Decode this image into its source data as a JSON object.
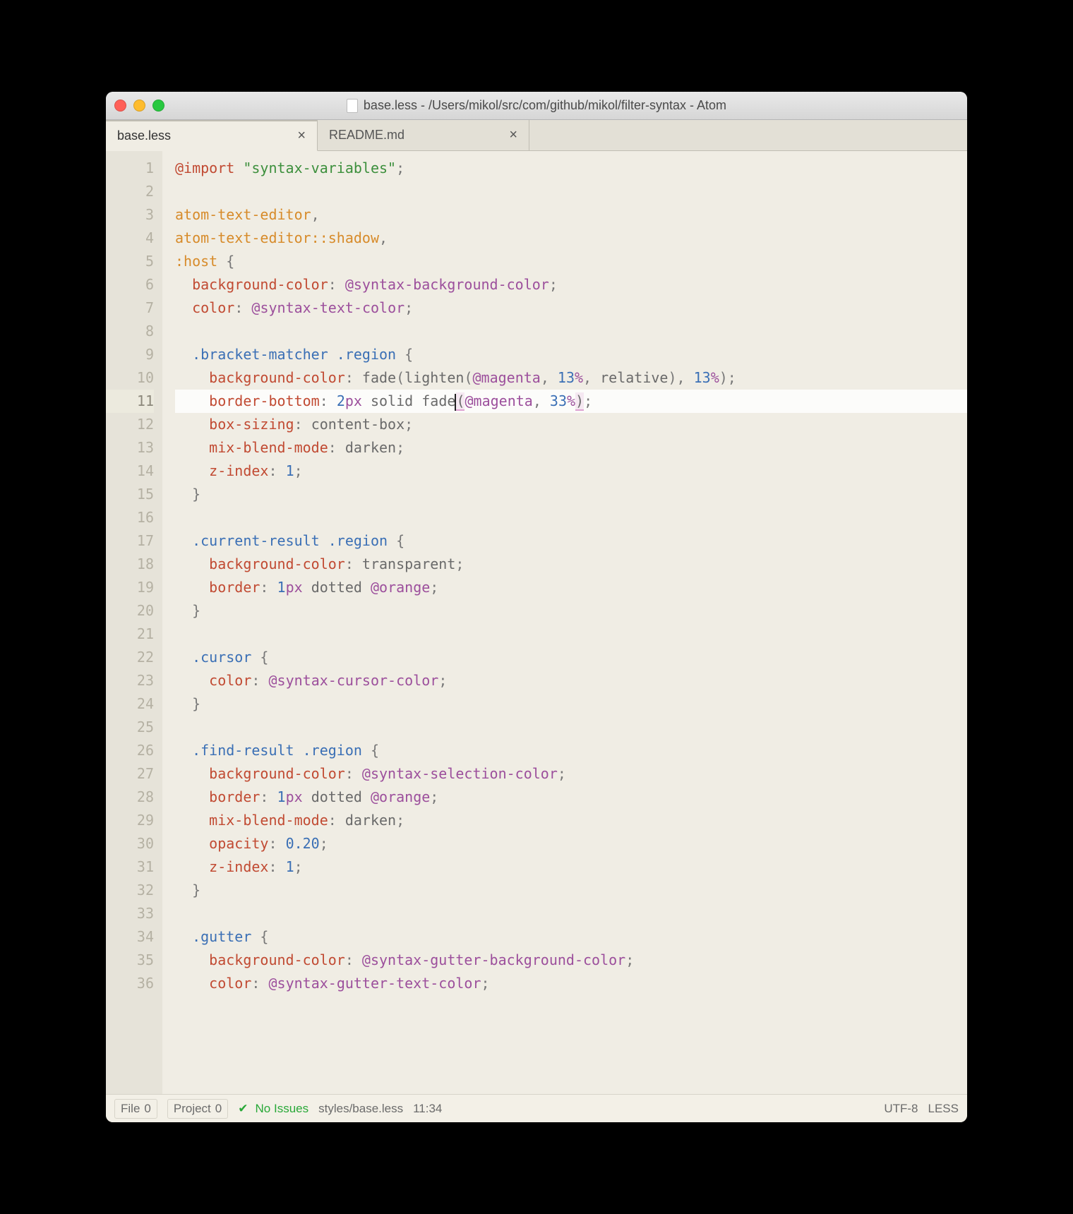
{
  "window": {
    "title": "base.less - /Users/mikol/src/com/github/mikol/filter-syntax - Atom"
  },
  "tabs": [
    {
      "label": "base.less",
      "active": true
    },
    {
      "label": "README.md",
      "active": false
    }
  ],
  "cursor_line": 11,
  "code_lines": [
    {
      "n": 1,
      "tokens": [
        [
          "kw-import",
          "@import"
        ],
        [
          "punct",
          " "
        ],
        [
          "string",
          "\"syntax-variables\""
        ],
        [
          "punct",
          ";"
        ]
      ]
    },
    {
      "n": 2,
      "tokens": []
    },
    {
      "n": 3,
      "tokens": [
        [
          "sel-tag",
          "atom-text-editor"
        ],
        [
          "punct",
          ","
        ]
      ]
    },
    {
      "n": 4,
      "tokens": [
        [
          "sel-tag",
          "atom-text-editor"
        ],
        [
          "sel-pseudo",
          "::shadow"
        ],
        [
          "punct",
          ","
        ]
      ]
    },
    {
      "n": 5,
      "tokens": [
        [
          "sel-pseudo",
          ":host"
        ],
        [
          "punct",
          " {"
        ]
      ]
    },
    {
      "n": 6,
      "tokens": [
        [
          "punct",
          "  "
        ],
        [
          "prop",
          "background-color"
        ],
        [
          "punct",
          ": "
        ],
        [
          "var",
          "@syntax-background-color"
        ],
        [
          "punct",
          ";"
        ]
      ]
    },
    {
      "n": 7,
      "tokens": [
        [
          "punct",
          "  "
        ],
        [
          "prop",
          "color"
        ],
        [
          "punct",
          ": "
        ],
        [
          "var",
          "@syntax-text-color"
        ],
        [
          "punct",
          ";"
        ]
      ]
    },
    {
      "n": 8,
      "tokens": []
    },
    {
      "n": 9,
      "tokens": [
        [
          "punct",
          "  "
        ],
        [
          "sel-class",
          ".bracket-matcher"
        ],
        [
          "punct",
          " "
        ],
        [
          "sel-class",
          ".region"
        ],
        [
          "punct",
          " {"
        ]
      ]
    },
    {
      "n": 10,
      "tokens": [
        [
          "punct",
          "    "
        ],
        [
          "prop",
          "background-color"
        ],
        [
          "punct",
          ": "
        ],
        [
          "func",
          "fade"
        ],
        [
          "punct",
          "("
        ],
        [
          "func",
          "lighten"
        ],
        [
          "punct",
          "("
        ],
        [
          "var",
          "@magenta"
        ],
        [
          "punct",
          ", "
        ],
        [
          "num",
          "13"
        ],
        [
          "unit",
          "%"
        ],
        [
          "punct",
          ", "
        ],
        [
          "val",
          "relative"
        ],
        [
          "punct",
          "), "
        ],
        [
          "num",
          "13"
        ],
        [
          "unit",
          "%"
        ],
        [
          "punct",
          ");"
        ]
      ]
    },
    {
      "n": 11,
      "tokens": [
        [
          "punct",
          "    "
        ],
        [
          "prop",
          "border-bottom"
        ],
        [
          "punct",
          ": "
        ],
        [
          "num",
          "2"
        ],
        [
          "unit",
          "px"
        ],
        [
          "punct",
          " "
        ],
        [
          "val",
          "solid"
        ],
        [
          "punct",
          " "
        ],
        [
          "func",
          "fade"
        ],
        [
          "cursor",
          ""
        ],
        [
          "bracket-match",
          "("
        ],
        [
          "var",
          "@magenta"
        ],
        [
          "punct",
          ", "
        ],
        [
          "num",
          "33"
        ],
        [
          "unit",
          "%"
        ],
        [
          "bracket-match",
          ")"
        ],
        [
          "punct",
          ";"
        ]
      ]
    },
    {
      "n": 12,
      "tokens": [
        [
          "punct",
          "    "
        ],
        [
          "prop",
          "box-sizing"
        ],
        [
          "punct",
          ": "
        ],
        [
          "val",
          "content-box"
        ],
        [
          "punct",
          ";"
        ]
      ]
    },
    {
      "n": 13,
      "tokens": [
        [
          "punct",
          "    "
        ],
        [
          "prop",
          "mix-blend-mode"
        ],
        [
          "punct",
          ": "
        ],
        [
          "val",
          "darken"
        ],
        [
          "punct",
          ";"
        ]
      ]
    },
    {
      "n": 14,
      "tokens": [
        [
          "punct",
          "    "
        ],
        [
          "prop",
          "z-index"
        ],
        [
          "punct",
          ": "
        ],
        [
          "num",
          "1"
        ],
        [
          "punct",
          ";"
        ]
      ]
    },
    {
      "n": 15,
      "tokens": [
        [
          "punct",
          "  }"
        ]
      ]
    },
    {
      "n": 16,
      "tokens": []
    },
    {
      "n": 17,
      "tokens": [
        [
          "punct",
          "  "
        ],
        [
          "sel-class",
          ".current-result"
        ],
        [
          "punct",
          " "
        ],
        [
          "sel-class",
          ".region"
        ],
        [
          "punct",
          " {"
        ]
      ]
    },
    {
      "n": 18,
      "tokens": [
        [
          "punct",
          "    "
        ],
        [
          "prop",
          "background-color"
        ],
        [
          "punct",
          ": "
        ],
        [
          "val",
          "transparent"
        ],
        [
          "punct",
          ";"
        ]
      ]
    },
    {
      "n": 19,
      "tokens": [
        [
          "punct",
          "    "
        ],
        [
          "prop",
          "border"
        ],
        [
          "punct",
          ": "
        ],
        [
          "num",
          "1"
        ],
        [
          "unit",
          "px"
        ],
        [
          "punct",
          " "
        ],
        [
          "val",
          "dotted"
        ],
        [
          "punct",
          " "
        ],
        [
          "var",
          "@orange"
        ],
        [
          "punct",
          ";"
        ]
      ]
    },
    {
      "n": 20,
      "tokens": [
        [
          "punct",
          "  }"
        ]
      ]
    },
    {
      "n": 21,
      "tokens": []
    },
    {
      "n": 22,
      "tokens": [
        [
          "punct",
          "  "
        ],
        [
          "sel-class",
          ".cursor"
        ],
        [
          "punct",
          " {"
        ]
      ]
    },
    {
      "n": 23,
      "tokens": [
        [
          "punct",
          "    "
        ],
        [
          "prop",
          "color"
        ],
        [
          "punct",
          ": "
        ],
        [
          "var",
          "@syntax-cursor-color"
        ],
        [
          "punct",
          ";"
        ]
      ]
    },
    {
      "n": 24,
      "tokens": [
        [
          "punct",
          "  }"
        ]
      ]
    },
    {
      "n": 25,
      "tokens": []
    },
    {
      "n": 26,
      "tokens": [
        [
          "punct",
          "  "
        ],
        [
          "sel-class",
          ".find-result"
        ],
        [
          "punct",
          " "
        ],
        [
          "sel-class",
          ".region"
        ],
        [
          "punct",
          " {"
        ]
      ]
    },
    {
      "n": 27,
      "tokens": [
        [
          "punct",
          "    "
        ],
        [
          "prop",
          "background-color"
        ],
        [
          "punct",
          ": "
        ],
        [
          "var",
          "@syntax-selection-color"
        ],
        [
          "punct",
          ";"
        ]
      ]
    },
    {
      "n": 28,
      "tokens": [
        [
          "punct",
          "    "
        ],
        [
          "prop",
          "border"
        ],
        [
          "punct",
          ": "
        ],
        [
          "num",
          "1"
        ],
        [
          "unit",
          "px"
        ],
        [
          "punct",
          " "
        ],
        [
          "val",
          "dotted"
        ],
        [
          "punct",
          " "
        ],
        [
          "var",
          "@orange"
        ],
        [
          "punct",
          ";"
        ]
      ]
    },
    {
      "n": 29,
      "tokens": [
        [
          "punct",
          "    "
        ],
        [
          "prop",
          "mix-blend-mode"
        ],
        [
          "punct",
          ": "
        ],
        [
          "val",
          "darken"
        ],
        [
          "punct",
          ";"
        ]
      ]
    },
    {
      "n": 30,
      "tokens": [
        [
          "punct",
          "    "
        ],
        [
          "prop",
          "opacity"
        ],
        [
          "punct",
          ": "
        ],
        [
          "num",
          "0.20"
        ],
        [
          "punct",
          ";"
        ]
      ]
    },
    {
      "n": 31,
      "tokens": [
        [
          "punct",
          "    "
        ],
        [
          "prop",
          "z-index"
        ],
        [
          "punct",
          ": "
        ],
        [
          "num",
          "1"
        ],
        [
          "punct",
          ";"
        ]
      ]
    },
    {
      "n": 32,
      "tokens": [
        [
          "punct",
          "  }"
        ]
      ]
    },
    {
      "n": 33,
      "tokens": []
    },
    {
      "n": 34,
      "tokens": [
        [
          "punct",
          "  "
        ],
        [
          "sel-class",
          ".gutter"
        ],
        [
          "punct",
          " {"
        ]
      ]
    },
    {
      "n": 35,
      "tokens": [
        [
          "punct",
          "    "
        ],
        [
          "prop",
          "background-color"
        ],
        [
          "punct",
          ": "
        ],
        [
          "var",
          "@syntax-gutter-background-color"
        ],
        [
          "punct",
          ";"
        ]
      ]
    },
    {
      "n": 36,
      "tokens": [
        [
          "punct",
          "    "
        ],
        [
          "prop",
          "color"
        ],
        [
          "punct",
          ": "
        ],
        [
          "var",
          "@syntax-gutter-text-color"
        ],
        [
          "punct",
          ";"
        ]
      ]
    }
  ],
  "status": {
    "file_label": "File",
    "file_count": "0",
    "project_label": "Project",
    "project_count": "0",
    "issues": "No Issues",
    "path": "styles/base.less",
    "cursor": "11:34",
    "encoding": "UTF-8",
    "grammar": "LESS"
  }
}
